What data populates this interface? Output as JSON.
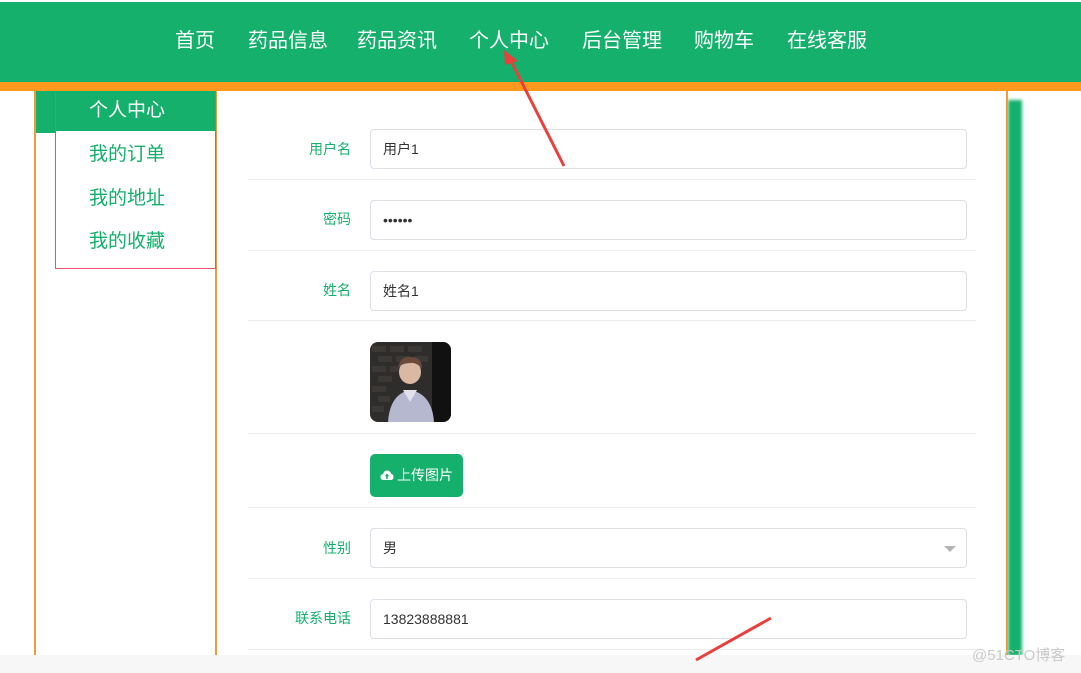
{
  "nav": {
    "items": [
      "首页",
      "药品信息",
      "药品资讯",
      "个人中心",
      "后台管理",
      "购物车",
      "在线客服"
    ]
  },
  "sidebar": {
    "items": [
      "个人中心",
      "我的订单",
      "我的地址",
      "我的收藏"
    ],
    "active": "个人中心"
  },
  "form": {
    "username": {
      "label": "用户名",
      "value": "用户1"
    },
    "password": {
      "label": "密码",
      "value": "••••••"
    },
    "name": {
      "label": "姓名",
      "value": "姓名1"
    },
    "upload_label": "上传图片",
    "gender": {
      "label": "性别",
      "value": "男"
    },
    "phone": {
      "label": "联系电话",
      "value": "13823888881"
    }
  },
  "watermark": "@51CTO博客",
  "colors": {
    "brand_green": "#14b06c",
    "accent_orange": "#ff9a1e",
    "annotation_red": "#e8413d"
  }
}
